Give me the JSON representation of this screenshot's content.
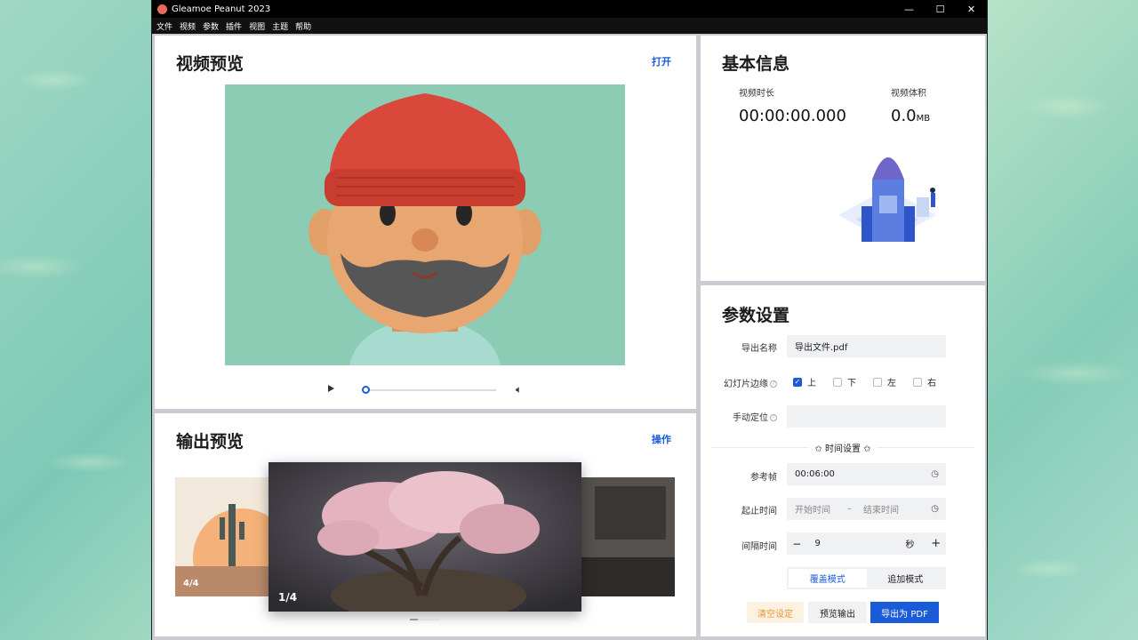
{
  "window": {
    "title": "Gleamoe Peanut 2023",
    "controls": {
      "minimize": "—",
      "maximize": "☐",
      "close": "✕"
    }
  },
  "menu": [
    "文件",
    "视频",
    "参数",
    "插件",
    "视图",
    "主题",
    "帮助"
  ],
  "video_preview": {
    "title": "视频预览",
    "open_link": "打开",
    "progress": 0
  },
  "basic_info": {
    "title": "基本信息",
    "duration_label": "视频时长",
    "duration_value": "00:00:00.000",
    "size_label": "视频体积",
    "size_value": "0.0",
    "size_unit": "MB"
  },
  "output_preview": {
    "title": "输出预览",
    "action_link": "操作",
    "left_caption": "4/4",
    "center_caption": "1/4"
  },
  "params": {
    "title": "参数设置",
    "export_name_label": "导出名称",
    "export_name_value": "导出文件.pdf",
    "slide_edge_label": "幻灯片边缘",
    "edges": [
      {
        "label": "上",
        "checked": true
      },
      {
        "label": "下",
        "checked": false
      },
      {
        "label": "左",
        "checked": false
      },
      {
        "label": "右",
        "checked": false
      }
    ],
    "manual_pos_label": "手动定位",
    "manual_pos_value": "",
    "time_section": "✩ 时间设置 ✩",
    "ref_frame_label": "参考帧",
    "ref_frame_value": "00:06:00",
    "range_label": "起止时间",
    "start_placeholder": "开始时间",
    "range_sep": "–",
    "end_placeholder": "结束时间",
    "interval_label": "间隔时间",
    "interval_minus": "−",
    "interval_value": "9",
    "interval_unit": "秒",
    "interval_plus": "+",
    "mode_overwrite": "覆盖模式",
    "mode_append": "追加模式",
    "btn_clear": "清空设定",
    "btn_preview": "预览输出",
    "btn_export": "导出为 PDF"
  },
  "colors": {
    "accent": "#1a5bd8",
    "clear_bg": "#fdf1e2",
    "clear_fg": "#e8962e",
    "video_bg": "#8ccbb4"
  }
}
